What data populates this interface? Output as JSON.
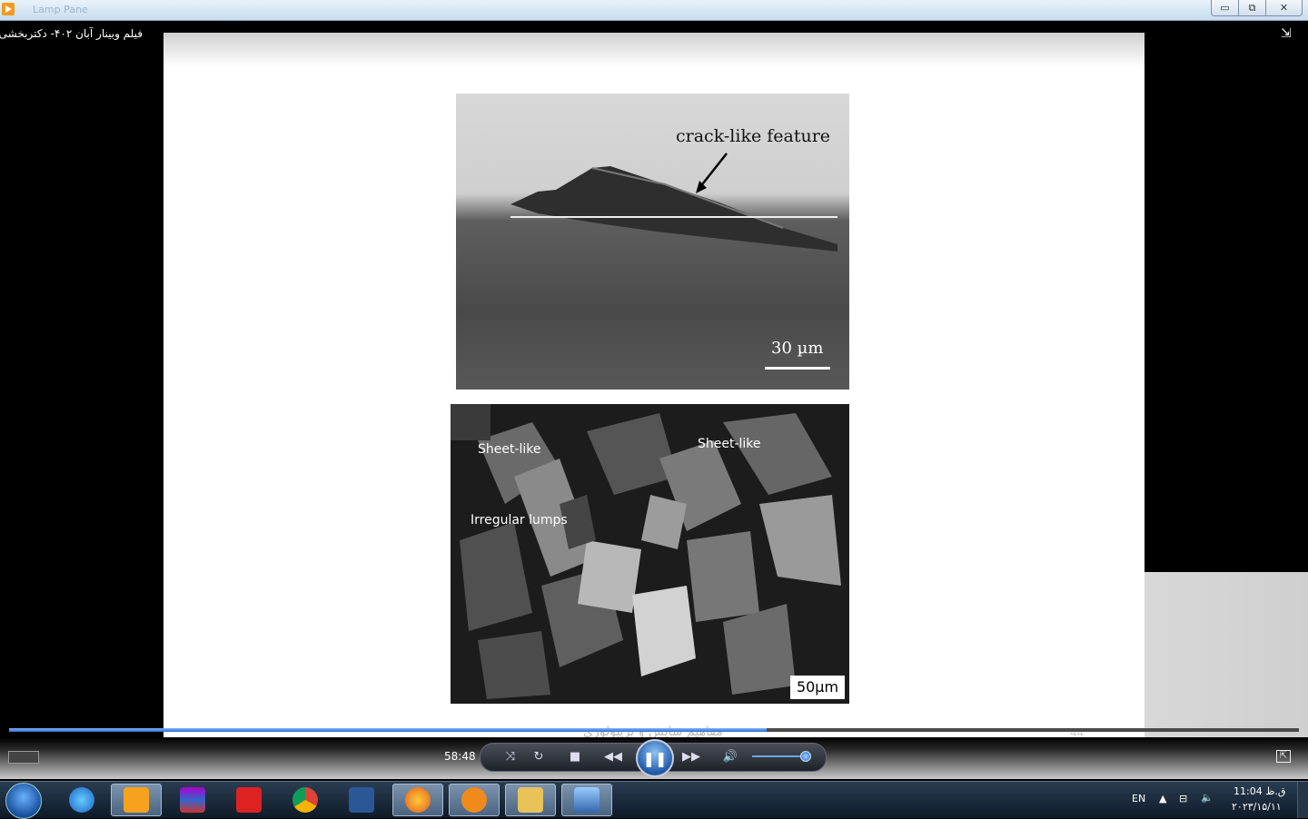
{
  "window": {
    "faded_title": "Lamp Pane",
    "controls": {
      "minimize": "▭",
      "maximize": "⧉",
      "close": "✕"
    }
  },
  "video": {
    "title": "فیلم وبینار آبان ۴۰۲- دکتربخشی",
    "fullscreen_icon": "⇲"
  },
  "slide": {
    "image1": {
      "annotation": "crack-like feature",
      "scale_label": "30 µm"
    },
    "image2": {
      "label_sheet_left": "Sheet-like",
      "label_sheet_right": "Sheet-like",
      "label_irregular": "Irregular lumps",
      "scale_label": "50µm"
    },
    "footer": "مفاهیم سایش و تریبولوژی",
    "page_number": "44"
  },
  "player": {
    "seek_progress": 0.587,
    "elapsed": "58:48",
    "volume": 0.9
  },
  "taskbar": {
    "language": "EN",
    "time": "ق.ظ 11:04",
    "date": "۲۰۲۳/۱۵/۱۱",
    "apps": [
      "internet-explorer",
      "media-player",
      "winrar",
      "acrobat",
      "chrome",
      "word",
      "firefox",
      "ecard",
      "file-explorer",
      "paint"
    ]
  }
}
